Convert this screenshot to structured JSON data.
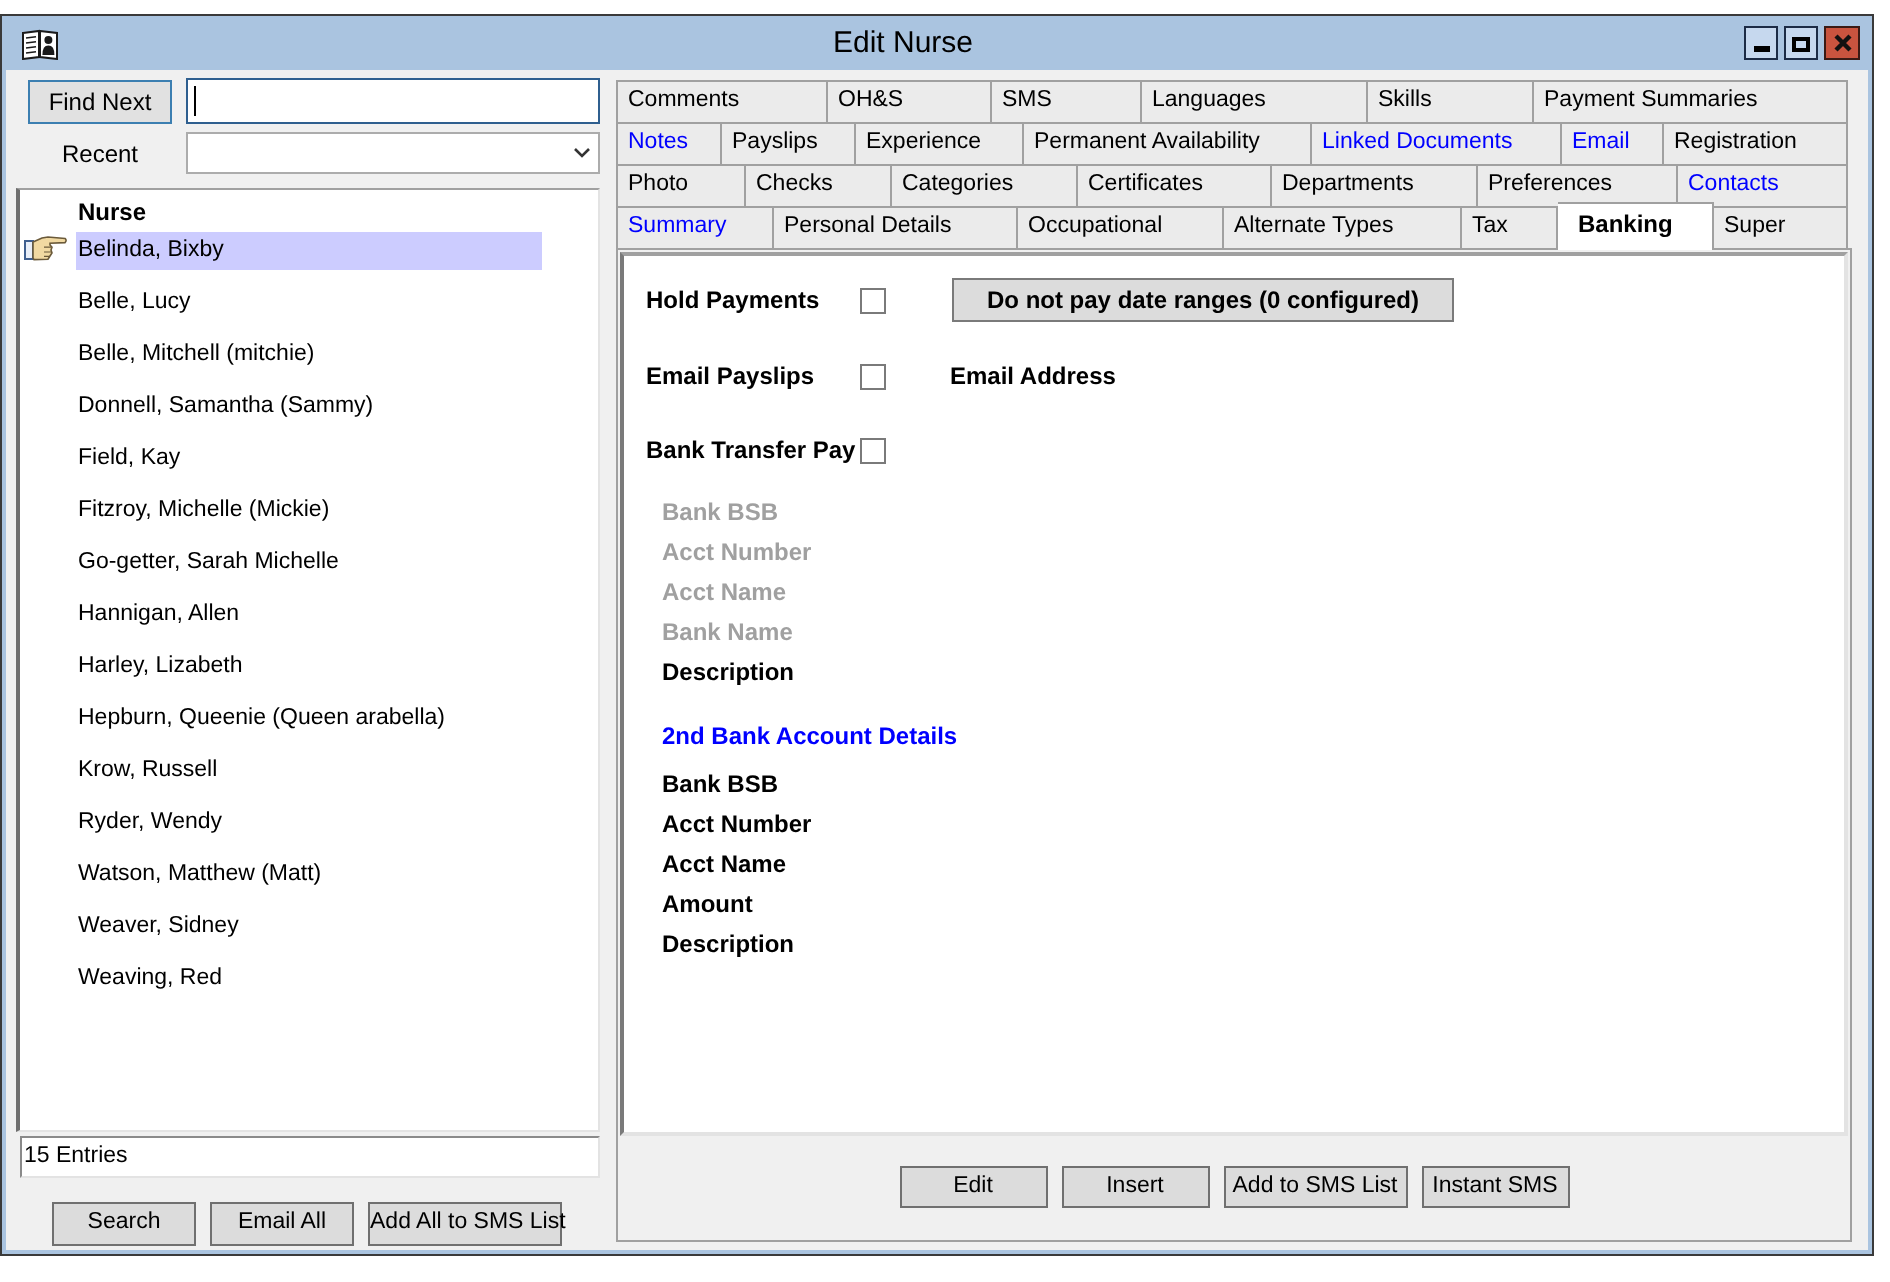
{
  "window": {
    "title": "Edit Nurse"
  },
  "find": {
    "button": "Find Next",
    "recent_label": "Recent"
  },
  "nurse_list": {
    "column": "Nurse",
    "rows": [
      {
        "name": "Belinda, Bixby",
        "selected": true
      },
      {
        "name": "Belle, Lucy",
        "selected": false
      },
      {
        "name": "Belle, Mitchell (mitchie)",
        "selected": false
      },
      {
        "name": "Donnell, Samantha (Sammy)",
        "selected": false
      },
      {
        "name": "Field, Kay",
        "selected": false
      },
      {
        "name": "Fitzroy, Michelle (Mickie)",
        "selected": false
      },
      {
        "name": "Go-getter, Sarah Michelle",
        "selected": false
      },
      {
        "name": "Hannigan, Allen",
        "selected": false
      },
      {
        "name": "Harley, Lizabeth",
        "selected": false
      },
      {
        "name": "Hepburn, Queenie (Queen arabella)",
        "selected": false
      },
      {
        "name": "Krow, Russell",
        "selected": false
      },
      {
        "name": "Ryder, Wendy",
        "selected": false
      },
      {
        "name": "Watson, Matthew (Matt)",
        "selected": false
      },
      {
        "name": "Weaver, Sidney",
        "selected": false
      },
      {
        "name": "Weaving, Red",
        "selected": false
      }
    ]
  },
  "entries_count": "15 Entries",
  "left_buttons": [
    "Search",
    "Email All",
    "Add All to SMS List"
  ],
  "tab_rows": [
    {
      "tabs": [
        {
          "label": "Comments",
          "selected": false,
          "highlighted": false
        },
        {
          "label": "OH&S",
          "selected": false,
          "highlighted": false
        },
        {
          "label": "SMS",
          "selected": false,
          "highlighted": false
        },
        {
          "label": "Languages",
          "selected": false,
          "highlighted": false
        },
        {
          "label": "Skills",
          "selected": false,
          "highlighted": false
        },
        {
          "label": "Payment Summaries",
          "selected": false,
          "highlighted": false
        }
      ]
    },
    {
      "tabs": [
        {
          "label": "Notes",
          "selected": false,
          "highlighted": true
        },
        {
          "label": "Payslips",
          "selected": false,
          "highlighted": false
        },
        {
          "label": "Experience",
          "selected": false,
          "highlighted": false
        },
        {
          "label": "Permanent Availability",
          "selected": false,
          "highlighted": false
        },
        {
          "label": "Linked Documents",
          "selected": false,
          "highlighted": true
        },
        {
          "label": "Email",
          "selected": false,
          "highlighted": true
        },
        {
          "label": "Registration",
          "selected": false,
          "highlighted": false
        }
      ]
    },
    {
      "tabs": [
        {
          "label": "Photo",
          "selected": false,
          "highlighted": false
        },
        {
          "label": "Checks",
          "selected": false,
          "highlighted": false
        },
        {
          "label": "Categories",
          "selected": false,
          "highlighted": false
        },
        {
          "label": "Certificates",
          "selected": false,
          "highlighted": false
        },
        {
          "label": "Departments",
          "selected": false,
          "highlighted": false
        },
        {
          "label": "Preferences",
          "selected": false,
          "highlighted": false
        },
        {
          "label": "Contacts",
          "selected": false,
          "highlighted": true
        }
      ]
    },
    {
      "tabs": [
        {
          "label": "Summary",
          "selected": false,
          "highlighted": true
        },
        {
          "label": "Personal Details",
          "selected": false,
          "highlighted": false
        },
        {
          "label": "Occupational",
          "selected": false,
          "highlighted": false
        },
        {
          "label": "Alternate Types",
          "selected": false,
          "highlighted": false
        },
        {
          "label": "Tax",
          "selected": false,
          "highlighted": false
        },
        {
          "label": "Banking",
          "selected": true,
          "highlighted": false
        },
        {
          "label": "Super",
          "selected": false,
          "highlighted": false
        }
      ]
    }
  ],
  "banking": {
    "options": [
      {
        "label": "Hold Payments",
        "checked": false,
        "button": "Do not pay date ranges (0 configured)"
      },
      {
        "label": "Email Payslips",
        "checked": false,
        "field_label": "Email Address"
      },
      {
        "label": "Bank Transfer Pay",
        "checked": false
      }
    ],
    "bank_fields": [
      {
        "label": "Bank BSB",
        "disabled": true
      },
      {
        "label": "Acct Number",
        "disabled": true
      },
      {
        "label": "Acct Name",
        "disabled": true
      },
      {
        "label": "Bank Name",
        "disabled": true
      },
      {
        "label": "Description",
        "disabled": false
      }
    ],
    "second_account": {
      "heading": "2nd Bank Account Details",
      "fields": [
        {
          "label": "Bank BSB",
          "disabled": false
        },
        {
          "label": "Acct Number",
          "disabled": false
        },
        {
          "label": "Acct Name",
          "disabled": false
        },
        {
          "label": "Amount",
          "disabled": false
        },
        {
          "label": "Description",
          "disabled": false
        }
      ]
    }
  },
  "bottom_buttons": [
    "Edit",
    "Insert",
    "Add to SMS List",
    "Instant SMS"
  ]
}
